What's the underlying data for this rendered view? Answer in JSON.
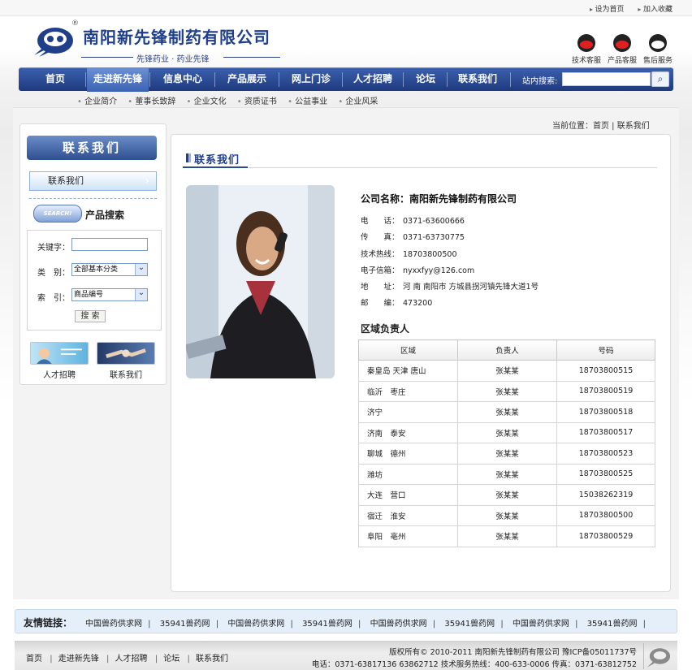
{
  "toplinks": {
    "homepage": "设为首页",
    "favorite": "加入收藏"
  },
  "logo": {
    "registered": "®",
    "title": "南阳新先锋制药有限公司",
    "slogan": "先锋药业 · 药业先锋"
  },
  "qq": [
    {
      "label": "技术客服"
    },
    {
      "label": "产品客服"
    },
    {
      "label": "售后服务"
    }
  ],
  "nav": {
    "items": [
      "首页",
      "走进新先锋",
      "信息中心",
      "产品展示",
      "网上门诊",
      "人才招聘",
      "论坛",
      "联系我们"
    ],
    "active_index": 1,
    "search_label": "站内搜索:",
    "search_value": ""
  },
  "subnav": [
    "企业简介",
    "董事长致辞",
    "企业文化",
    "资质证书",
    "公益事业",
    "企业风采"
  ],
  "breadcrumb": "当前位置：首页 | 联系我们",
  "sidebar": {
    "title": "联系我们",
    "menu_item": "联系我们",
    "search_badge": "SEARCH!",
    "search_title": "产品搜索",
    "form": {
      "keyword_label": "关键字：",
      "keyword_value": "",
      "category_label": "类　别：",
      "category_value": "全部基本分类",
      "index_label": "索　引：",
      "index_value": "商品编号",
      "submit_label": "搜 索"
    },
    "promos": [
      {
        "label": "人才招聘"
      },
      {
        "label": "联系我们"
      }
    ]
  },
  "main": {
    "title": "联系我们",
    "company": "公司名称：南阳新先锋制药有限公司",
    "info": [
      {
        "key": "电　　话：",
        "value": "0371-63600666"
      },
      {
        "key": "传　　真：",
        "value": "0371-63730775"
      },
      {
        "key": "技术热线：",
        "value": "18703800500"
      },
      {
        "key": "电子信箱：",
        "value": "nyxxfyy@126.com"
      },
      {
        "key": "地　　址：",
        "value": "河 南 南阳市 方城县拐河镇先锋大道1号"
      },
      {
        "key": "邮　　编：",
        "value": "473200"
      }
    ],
    "region_title": "区域负责人",
    "table": {
      "headers": [
        "区域",
        "负责人",
        "号码"
      ],
      "rows": [
        [
          "秦皇岛 天津 唐山",
          "张某某",
          "18703800515"
        ],
        [
          "临沂　枣庄",
          "张某某",
          "18703800519"
        ],
        [
          "济宁",
          "张某某",
          "18703800518"
        ],
        [
          "济南　泰安",
          "张某某",
          "18703800517"
        ],
        [
          "聊城　德州",
          "张某某",
          "18703800523"
        ],
        [
          "潍坊",
          "张某某",
          "18703800525"
        ],
        [
          "大连　营口",
          "张某某",
          "15038262319"
        ],
        [
          "宿迁　淮安",
          "张某某",
          "18703800500"
        ],
        [
          "阜阳　亳州",
          "张某某",
          "18703800529"
        ]
      ]
    }
  },
  "friends": {
    "label": "友情链接：",
    "links": [
      "中国兽药供求网",
      "35941兽药网",
      "中国兽药供求网",
      "35941兽药网",
      "中国兽药供求网",
      "35941兽药网",
      "中国兽药供求网",
      "35941兽药网"
    ]
  },
  "footer": {
    "nav": [
      "首页",
      "走进新先锋",
      "人才招聘",
      "论坛",
      "联系我们"
    ],
    "copyright": "版权所有© 2010-2011 南阳新先锋制药有限公司 豫ICP备05011737号",
    "contact": "电话：0371-63817136 63862712 技术服务热线：400-633-0006 传真：0371-63812752"
  },
  "colors": {
    "brand": "#1f3f8a",
    "nav": "#2a4b94",
    "friend_bg": "#e4effa"
  }
}
